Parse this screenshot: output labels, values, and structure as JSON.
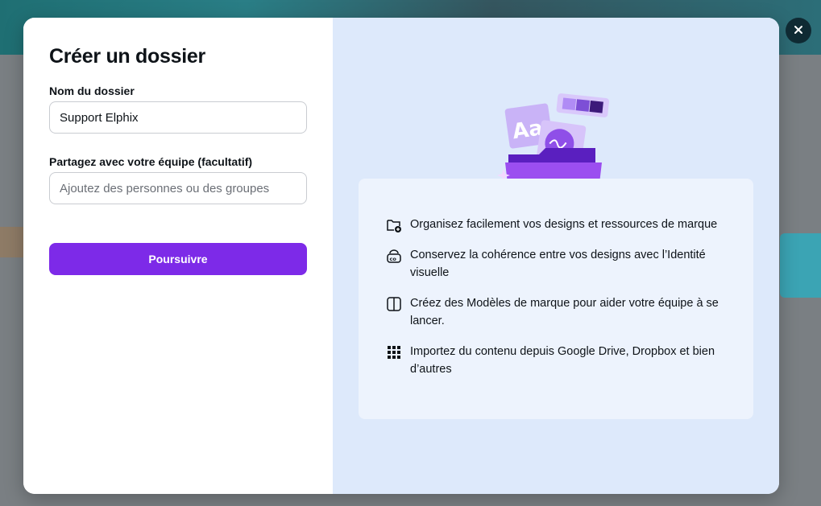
{
  "modal": {
    "title": "Créer un dossier",
    "folder_name": {
      "label": "Nom du dossier",
      "value": "Support Elphix"
    },
    "share": {
      "label": "Partagez avec votre équipe (facultatif)",
      "placeholder": "Ajoutez des personnes ou des groupes"
    },
    "submit_label": "Poursuivre",
    "close_icon": "close-icon"
  },
  "features": [
    {
      "icon": "folder-plus-icon",
      "text": "Organisez facilement vos designs et ressources de marque"
    },
    {
      "icon": "brand-kit-icon",
      "text": "Conservez la cohérence entre vos designs avec l’Identité visuelle"
    },
    {
      "icon": "template-icon",
      "text": "Créez des Modèles de marque pour aider votre équipe à se lancer."
    },
    {
      "icon": "apps-grid-icon",
      "text": "Importez du contenu depuis Google Drive, Dropbox et bien d’autres"
    }
  ],
  "colors": {
    "accent": "#7d2ae8",
    "right_pane_bg": "#dde9fb",
    "feature_card_bg": "#edf3fd",
    "close_button_bg": "#0f2a33"
  }
}
